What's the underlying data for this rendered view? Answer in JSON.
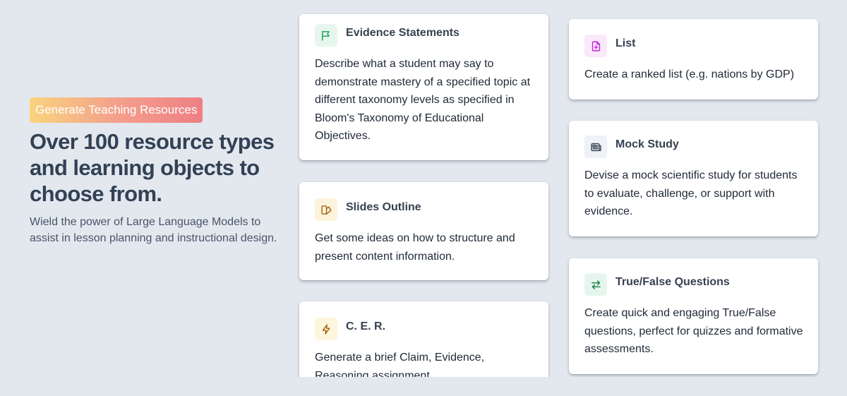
{
  "hero": {
    "badge": "Generate Teaching Resources",
    "headline": "Over 100 resource types and learning objects to choose from.",
    "subtext": "Wield the power of Large Language Models to assist in lesson planning and instructional design."
  },
  "cards": [
    {
      "title": "Evidence Statements",
      "description": "Describe what a student may say to demonstrate mastery of a specified topic at different taxonomy levels as specified in Bloom's Taxonomy of Educational Objectives.",
      "icon": "flag-icon",
      "icon_color": "#16a34a",
      "icon_bg": "#e6f6ee"
    },
    {
      "title": "Slides Outline",
      "description": "Get some ideas on how to structure and present content information.",
      "icon": "slides-icon",
      "icon_color": "#a16207",
      "icon_bg": "#fdf3dc"
    },
    {
      "title": "C. E. R.",
      "description": "Generate a brief Claim, Evidence, Reasoning assignment.",
      "icon": "lightning-icon",
      "icon_color": "#a16207",
      "icon_bg": "#fdf6dc"
    },
    {
      "title": "List",
      "description": "Create a ranked list (e.g. nations by GDP)",
      "icon": "file-plus-icon",
      "icon_color": "#c026d3",
      "icon_bg": "#fae8fb"
    },
    {
      "title": "Mock Study",
      "description": "Devise a mock scientific study for students to evaluate, challenge, or support with evidence.",
      "icon": "newspaper-icon",
      "icon_color": "#334155",
      "icon_bg": "#eef1f5"
    },
    {
      "title": "True/False Questions",
      "description": "Create quick and engaging True/False questions, perfect for quizzes and formative assessments.",
      "icon": "swap-arrows-icon",
      "icon_color": "#15803d",
      "icon_bg": "#e6f6ee"
    }
  ]
}
